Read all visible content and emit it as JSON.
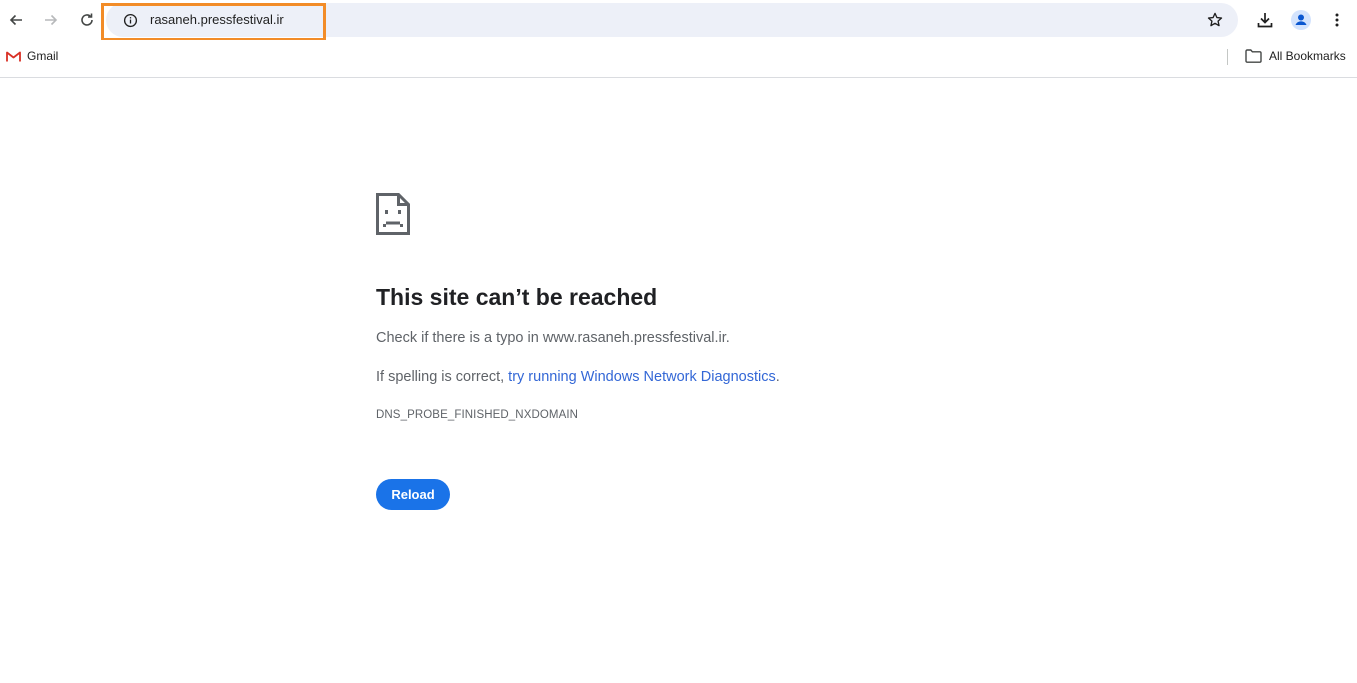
{
  "browser": {
    "url": "rasaneh.pressfestival.ir",
    "back_icon": "arrow-left-icon",
    "forward_icon": "arrow-right-icon",
    "reload_icon": "refresh-icon",
    "site_info_icon": "info-icon",
    "bookmark_star_icon": "star-icon",
    "downloads_icon": "download-icon",
    "profile_icon": "person-icon",
    "menu_icon": "three-dots-vertical-icon",
    "highlight_color": "#f28c28"
  },
  "bookmarks": {
    "items": [
      {
        "label": "Gmail",
        "icon": "gmail-icon"
      }
    ],
    "all_bookmarks": {
      "label": "All Bookmarks",
      "icon": "folder-icon"
    }
  },
  "error_page": {
    "icon": "sad-page-icon",
    "headline": "This site can’t be reached",
    "check_text": "Check if there is a typo in www.rasaneh.pressfestival.ir.",
    "spelling_prefix": "If spelling is correct, ",
    "diagnostics_link": "try running Windows Network Diagnostics",
    "spelling_suffix": ".",
    "error_code": "DNS_PROBE_FINISHED_NXDOMAIN",
    "reload_label": "Reload",
    "accent_color": "#1a73e8"
  }
}
